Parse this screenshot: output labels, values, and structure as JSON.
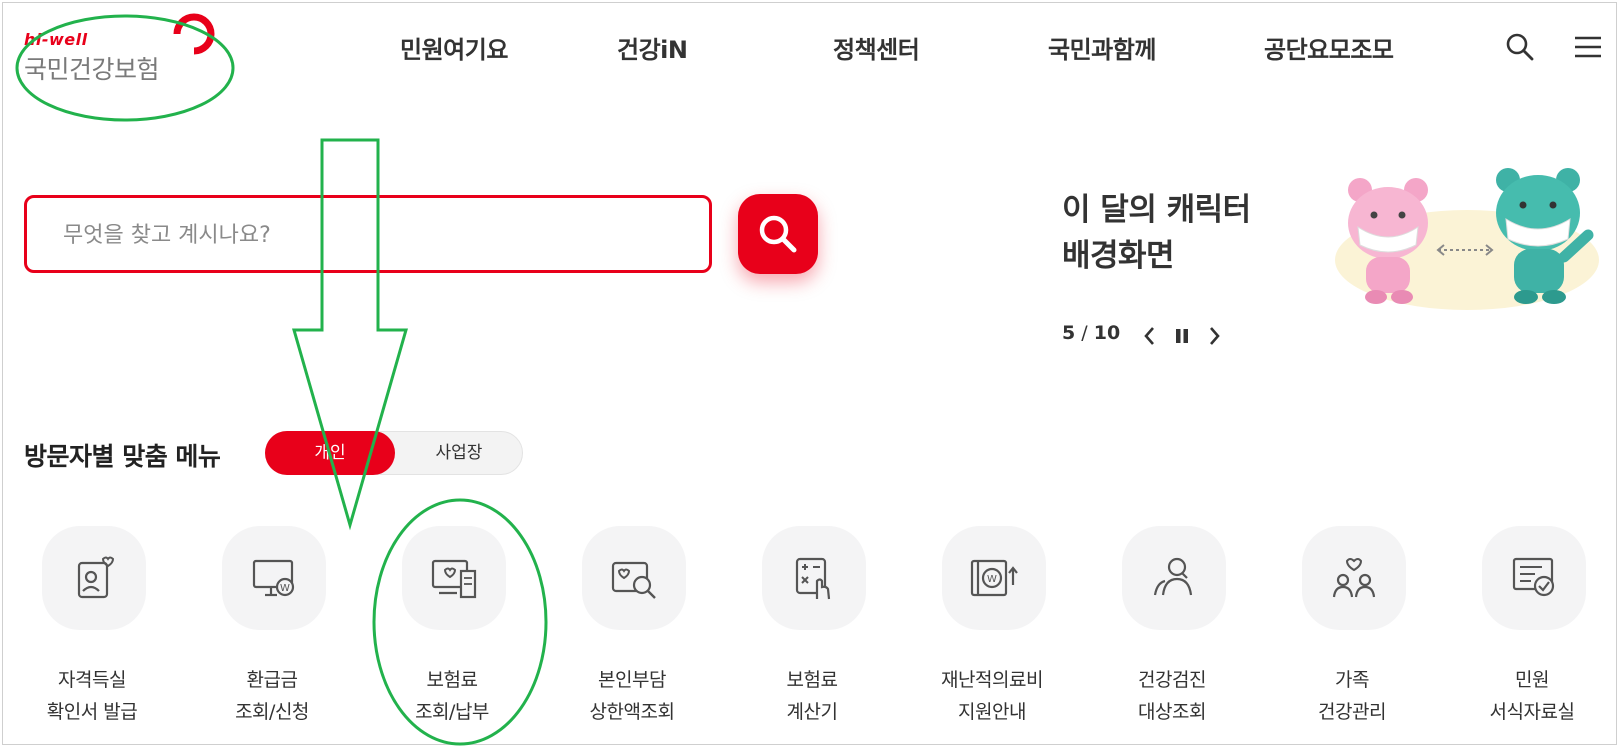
{
  "header": {
    "logo_small": "hi-well",
    "logo_name": "국민건강보험",
    "nav": [
      "민원여기요",
      "건강iN",
      "정책센터",
      "국민과함께",
      "공단요모조모"
    ],
    "search_icon": "search-icon",
    "menu_icon": "hamburger-menu-icon"
  },
  "search": {
    "placeholder": "무엇을 찾고 계시나요?"
  },
  "banner": {
    "title_line1": "이 달의 캐릭터",
    "title_line2": "배경화면",
    "current": "5",
    "separator": "/",
    "total": "10"
  },
  "visitor_menu": {
    "title": "방문자별 맞춤 메뉴",
    "options": [
      "개인",
      "사업장"
    ],
    "selected": "개인"
  },
  "quick_menu": [
    {
      "line1": "자격득실",
      "line2": "확인서 발급",
      "icon": "id-card-heart-icon"
    },
    {
      "line1": "환급금",
      "line2": "조회/신청",
      "icon": "monitor-won-icon"
    },
    {
      "line1": "보험료",
      "line2": "조회/납부",
      "icon": "receipt-heart-icon"
    },
    {
      "line1": "본인부담",
      "line2": "상한액조회",
      "icon": "card-search-icon"
    },
    {
      "line1": "보험료",
      "line2": "계산기",
      "icon": "calculator-hand-icon"
    },
    {
      "line1": "재난적의료비",
      "line2": "지원안내",
      "icon": "book-won-up-icon"
    },
    {
      "line1": "건강검진",
      "line2": "대상조회",
      "icon": "people-search-icon"
    },
    {
      "line1": "가족",
      "line2": "건강관리",
      "icon": "family-heart-icon"
    },
    {
      "line1": "민원",
      "line2": "서식자료실",
      "icon": "document-check-icon"
    }
  ],
  "colors": {
    "brand_red": "#e8001a",
    "annotation_green": "#22b24c",
    "icon_bg": "#f4f4f5"
  }
}
